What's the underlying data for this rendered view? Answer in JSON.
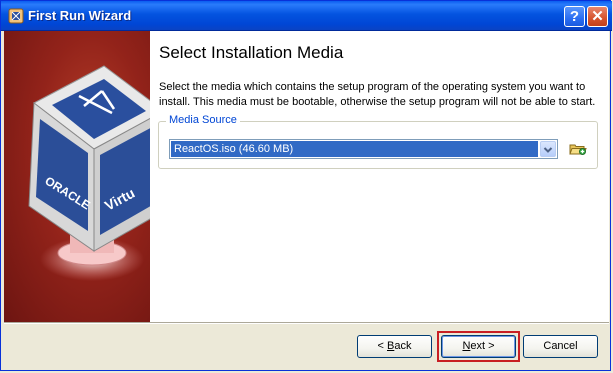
{
  "window": {
    "title": "First Run Wizard",
    "help_glyph": "?",
    "close_glyph": "✕"
  },
  "side_image": {
    "text_oracle": "ORACLE",
    "text_virtual": "Virtu"
  },
  "page": {
    "title": "Select Installation Media",
    "description": "Select the media which contains the setup program of the operating system you want to install. This media must be bootable, otherwise the setup program will not be able to start."
  },
  "media_source": {
    "label": "Media Source",
    "selected": "ReactOS.iso (46.60 MB)"
  },
  "buttons": {
    "back_prefix": "< ",
    "back_hotkey": "B",
    "back_rest": "ack",
    "next_hotkey": "N",
    "next_rest": "ext >",
    "cancel": "Cancel"
  },
  "colors": {
    "titlebar": "#0054e3",
    "selection": "#316ac5",
    "highlight_frame": "#c81e23",
    "group_label": "#0046d5"
  }
}
